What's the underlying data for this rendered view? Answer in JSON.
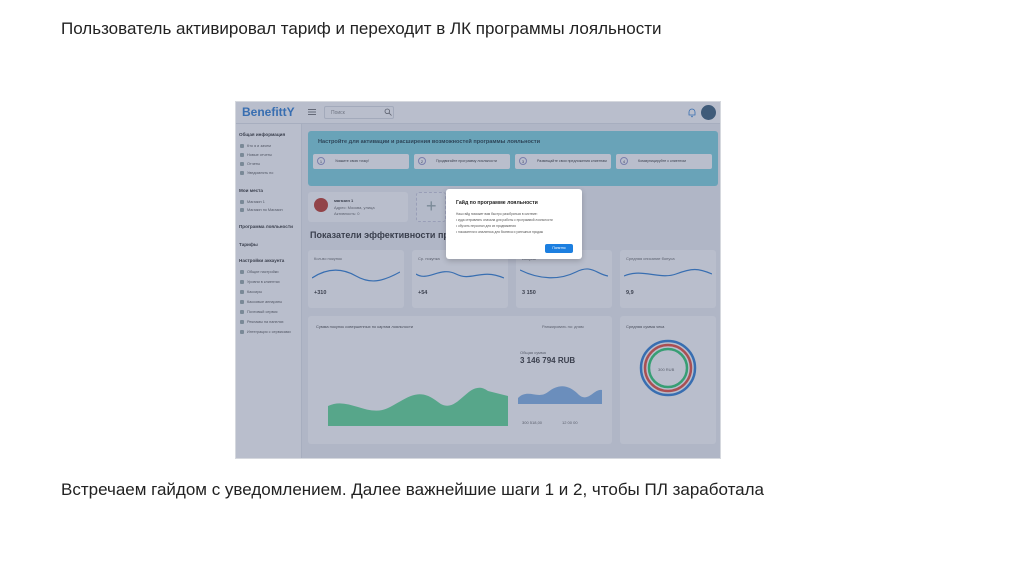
{
  "slide": {
    "title": "Пользователь активировал тариф и переходит в ЛК программы лояльности",
    "caption": "Встречаем гайдом с уведомлением. Далее важнейшие шаги 1 и 2, чтобы ПЛ заработала"
  },
  "app": {
    "logo": "BenefittY",
    "search_placeholder": "Поиск"
  },
  "sidebar": {
    "general_title": "Общая информация",
    "general_items": [
      "Кто я и зачем",
      "Новые отчеты",
      "Отчеты",
      "Уведомлять по"
    ],
    "stores_title": "Мои места",
    "stores_items": [
      "Магазин 1",
      "Магазин по Магазин"
    ],
    "loyalty_title": "Программа лояльности",
    "tariffs_title": "Тарифы",
    "settings_title": "Настройки аккаунта",
    "settings_items": [
      "Общие настройки",
      "Уровни в клиентах",
      "Кассиры",
      "Кассовые аппараты",
      "Почтовый сервис",
      "Рекламы на панелях",
      "Интеграция с сервисами"
    ]
  },
  "banner": {
    "title": "Настройте для активации и расширения возможностей программы лояльности",
    "steps": [
      {
        "num": "1",
        "label": "Укажите свою точку!"
      },
      {
        "num": "2",
        "label": "Продвигайте программу лояльности"
      },
      {
        "num": "3",
        "label": "Размещайте свои предложения клиентам"
      },
      {
        "num": "4",
        "label": "Коммуницируйте с клиентом"
      }
    ]
  },
  "store_card": {
    "name": "магазин 1",
    "line1": "Адрес: Москва, улица",
    "line2": "Активность: 0"
  },
  "section_title": "Показатели эффективности программы",
  "metrics": [
    {
      "label": "Кол-во покупок",
      "value": "+310"
    },
    {
      "label": "Ср. покупка",
      "value": "+54"
    },
    {
      "label": "Бонусы",
      "value": "3 150"
    },
    {
      "label": "Средняя списание бонуса",
      "value": "9,9"
    }
  ],
  "main_chart": {
    "title": "Сумма покупок совершенных по картам лояльности",
    "filter": "Ранжировать по: дням",
    "total_label": "Общая сумма",
    "total_value": "3 146 794 RUB",
    "legend": [
      "300 518,00",
      "12 00 00"
    ]
  },
  "donut_card": {
    "title": "Средняя сумма чека",
    "center": "300 RUB"
  },
  "modal": {
    "title": "Гайд по программе лояльности",
    "lines": [
      "Наш гайд поможет вам быстро разобраться в системе:",
      "• куда отправлять сначала для работы с программой лояльности",
      "• обучить персонал для их продвижения",
      "• показатели и аналитика для бизнеса и успешных продаж"
    ],
    "button": "Понятно"
  },
  "colors": {
    "banner": "#7fd4df",
    "accent": "#1c7fe0",
    "overlay": "rgba(70,84,120,0.38)"
  }
}
